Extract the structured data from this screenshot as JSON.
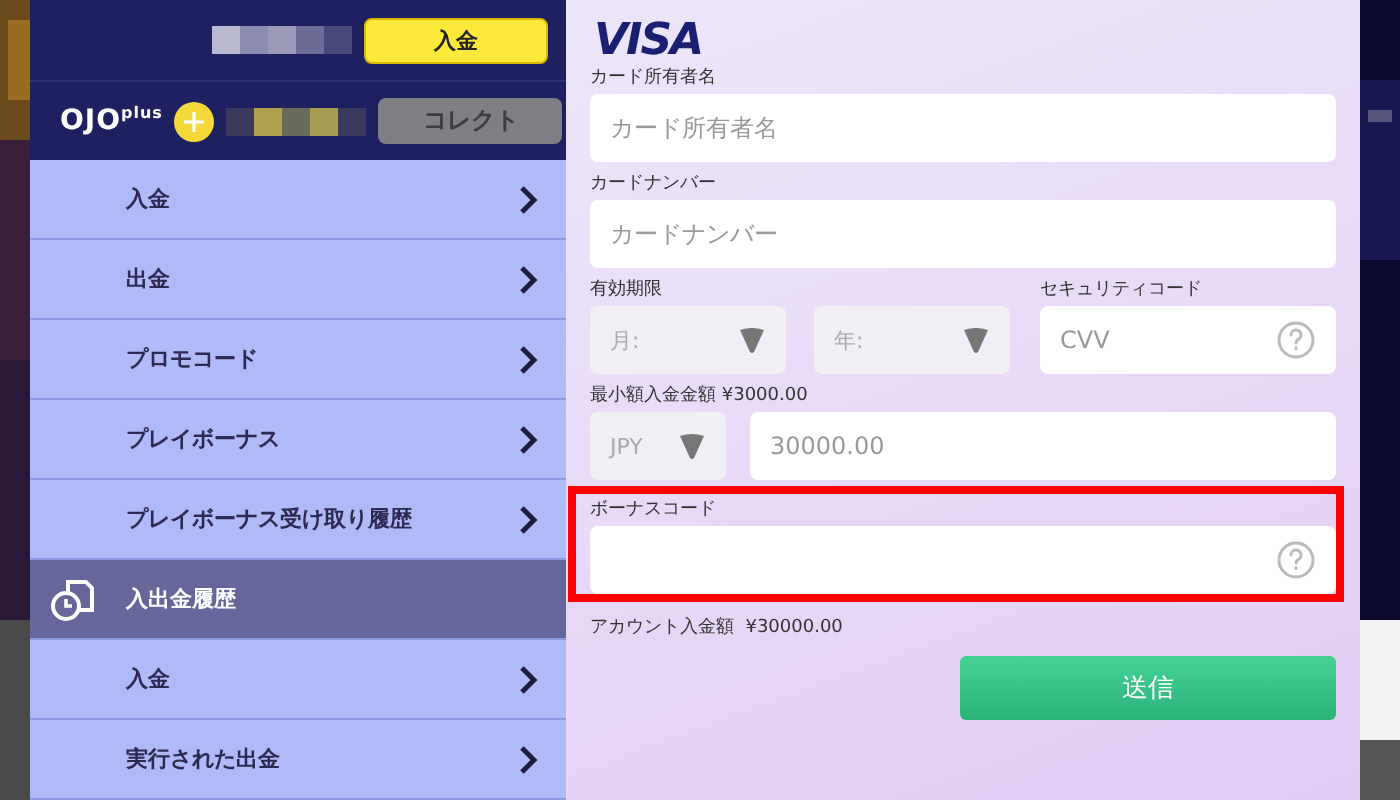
{
  "account": {
    "deposit_button": "入金",
    "logo": "OJO",
    "logo_sup": "plus",
    "collect_button": "コレクト"
  },
  "menu": [
    {
      "kind": "link",
      "label": "入金"
    },
    {
      "kind": "link",
      "label": "出金"
    },
    {
      "kind": "link",
      "label": "プロモコード"
    },
    {
      "kind": "link",
      "label": "プレイボーナス"
    },
    {
      "kind": "link",
      "label": "プレイボーナス受け取り履歴"
    },
    {
      "kind": "section",
      "label": "入出金履歴"
    },
    {
      "kind": "link",
      "label": "入金"
    },
    {
      "kind": "link",
      "label": "実行された出金"
    }
  ],
  "form": {
    "card_brand": "VISA",
    "holder": {
      "label": "カード所有者名",
      "placeholder": "カード所有者名"
    },
    "number": {
      "label": "カードナンバー",
      "placeholder": "カードナンバー"
    },
    "expiry": {
      "label": "有効期限",
      "month": "月:",
      "year": "年:"
    },
    "cvv": {
      "label": "セキュリティコード",
      "placeholder": "CVV"
    },
    "min_deposit": "最小額入金金額 ¥3000.00",
    "currency": "JPY",
    "amount": "30000.00",
    "bonus": {
      "label": "ボーナスコード",
      "highlighted": true
    },
    "account_deposit": "アカウント入金額  ¥30000.00",
    "submit": "送信"
  }
}
